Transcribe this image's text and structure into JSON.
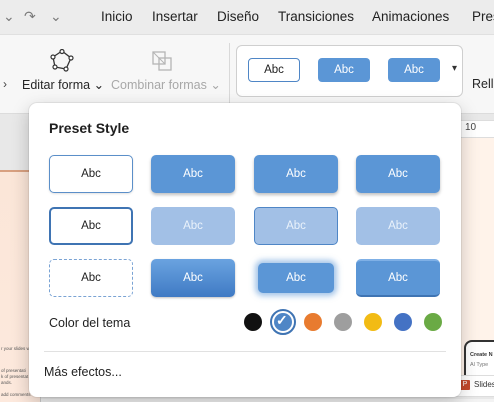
{
  "tabs": [
    "Inicio",
    "Insertar",
    "Diseño",
    "Transiciones",
    "Animaciones",
    "Pres"
  ],
  "ribbon": {
    "edit_shape": "Editar forma",
    "merge_shapes": "Combinar formas",
    "right_cut": "Rell"
  },
  "gallery": {
    "items": [
      "Abc",
      "Abc",
      "Abc"
    ]
  },
  "canvas": {
    "thumb_lines": [
      "r your slides wi",
      "of presentati",
      "k of presentat",
      "ands.",
      "add comments"
    ],
    "ruler_value": "10",
    "phone_lines": [
      "Create N",
      "Al Type"
    ],
    "status_label": "Slides"
  },
  "popup": {
    "title": "Preset Style",
    "swatches": [
      "Abc",
      "Abc",
      "Abc",
      "Abc",
      "Abc",
      "Abc",
      "Abc",
      "Abc",
      "Abc",
      "Abc",
      "Abc",
      "Abc"
    ],
    "color_label": "Color del tema",
    "theme_colors": [
      "#111111",
      "#4f86c6",
      "#e87b2f",
      "#9e9e9e",
      "#f2bb14",
      "#4472c4",
      "#6aaa45"
    ],
    "selected_color_index": 1,
    "more_effects": "Más efectos..."
  }
}
